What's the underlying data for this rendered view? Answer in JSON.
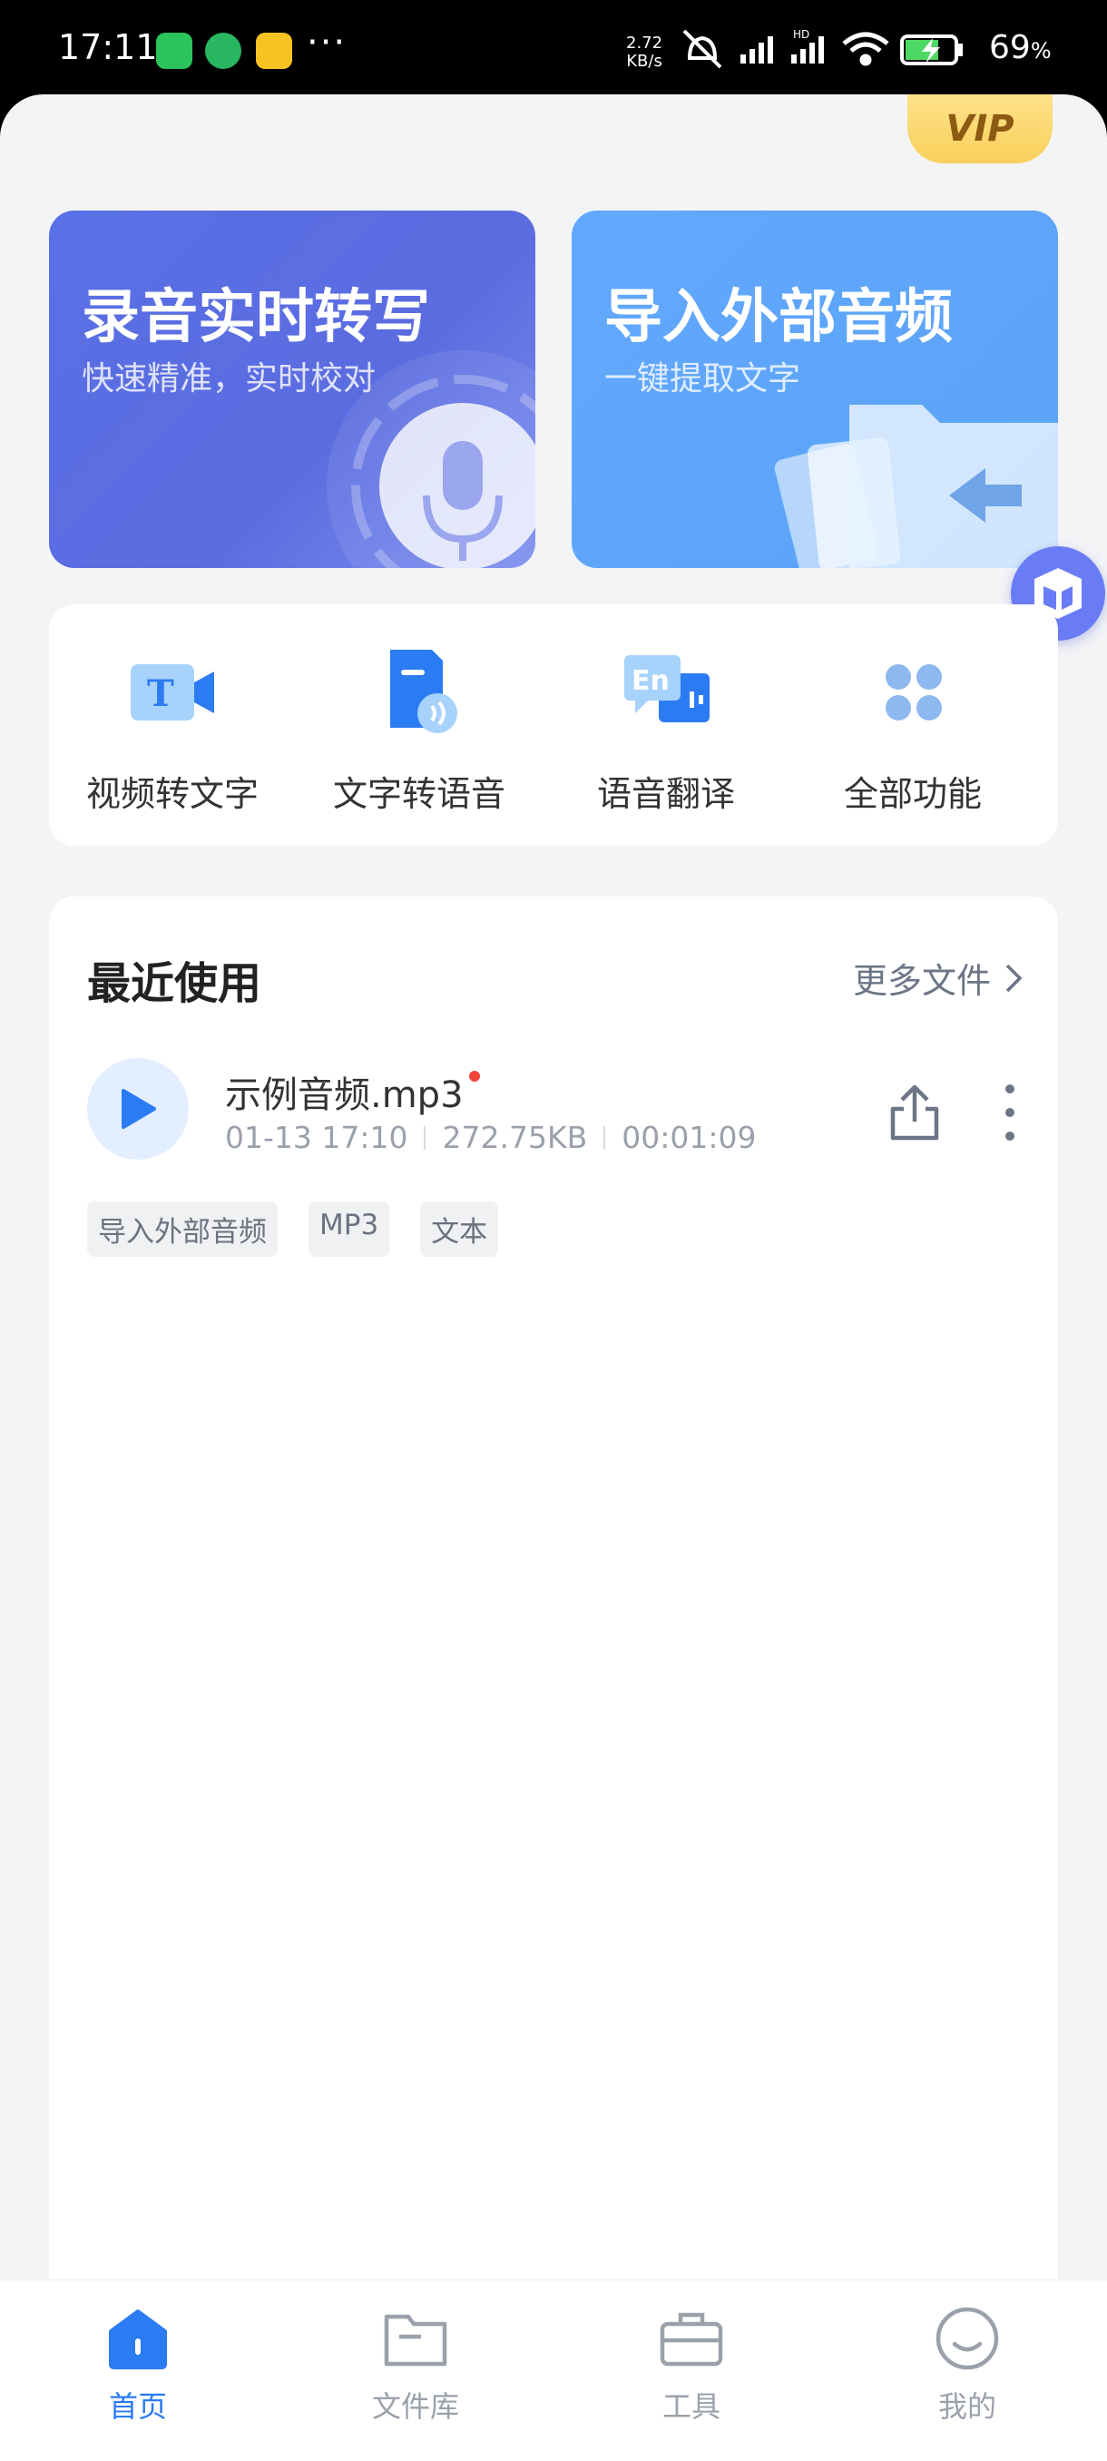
{
  "status": {
    "time": "17:11",
    "dots": "···",
    "net_speed_value": "2.72",
    "net_speed_unit": "KB/s",
    "battery": "69",
    "battery_unit": "%"
  },
  "vip": {
    "label": "VIP"
  },
  "cards": {
    "record": {
      "title": "录音实时转写",
      "subtitle": "快速精准，实时校对"
    },
    "import": {
      "title": "导入外部音频",
      "subtitle": "一键提取文字"
    }
  },
  "features": [
    {
      "label": "视频转文字",
      "icon": "video-to-text-icon"
    },
    {
      "label": "文字转语音",
      "icon": "text-to-speech-icon"
    },
    {
      "label": "语音翻译",
      "icon": "voice-translate-icon"
    },
    {
      "label": "全部功能",
      "icon": "all-features-icon"
    }
  ],
  "recent": {
    "title": "最近使用",
    "more_label": "更多文件",
    "file": {
      "name": "示例音频.mp3",
      "date": "01-13 17:10",
      "size": "272.75KB",
      "duration": "00:01:09",
      "tags": [
        "导入外部音频",
        "MP3",
        "文本"
      ]
    }
  },
  "tabs": [
    {
      "label": "首页",
      "active": true
    },
    {
      "label": "文件库",
      "active": false
    },
    {
      "label": "工具",
      "active": false
    },
    {
      "label": "我的",
      "active": false
    }
  ],
  "colors": {
    "accent": "#2b7bf3",
    "record_card": "#5a6ee4",
    "import_card": "#60a6fb",
    "vip_gold": "#f8cf5a"
  }
}
